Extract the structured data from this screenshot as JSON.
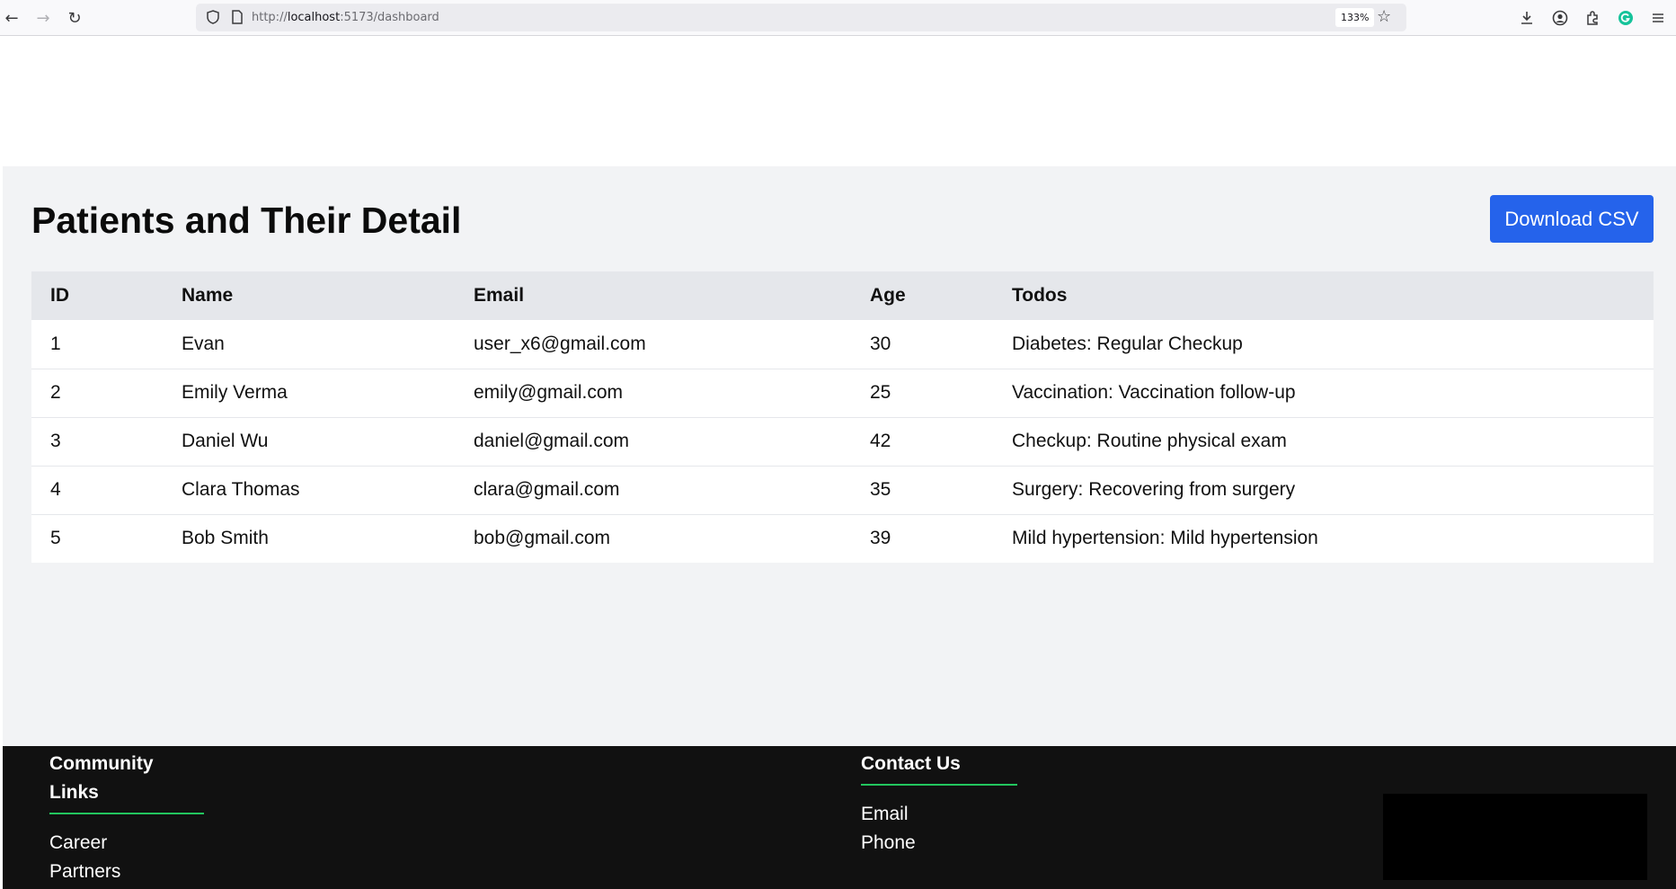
{
  "browser": {
    "url_prefix": "http://",
    "url_host": "localhost",
    "url_rest": ":5173/dashboard",
    "zoom": "133%"
  },
  "page": {
    "title": "Patients and Their Detail",
    "download_button": "Download CSV"
  },
  "table": {
    "headers": [
      "ID",
      "Name",
      "Email",
      "Age",
      "Todos"
    ],
    "rows": [
      [
        "1",
        "Evan",
        "user_x6@gmail.com",
        "30",
        "Diabetes: Regular Checkup"
      ],
      [
        "2",
        "Emily Verma",
        "emily@gmail.com",
        "25",
        "Vaccination: Vaccination follow-up"
      ],
      [
        "3",
        "Daniel Wu",
        "daniel@gmail.com",
        "42",
        "Checkup: Routine physical exam"
      ],
      [
        "4",
        "Clara Thomas",
        "clara@gmail.com",
        "35",
        "Surgery: Recovering from surgery"
      ],
      [
        "5",
        "Bob Smith",
        "bob@gmail.com",
        "39",
        "Mild hypertension: Mild hypertension"
      ]
    ]
  },
  "footer": {
    "community_heading_line1": "Community",
    "community_heading_line2": "Links",
    "community_links": [
      "Career",
      "Partners"
    ],
    "contact_heading": "Contact Us",
    "contact_links": [
      "Email",
      "Phone"
    ]
  },
  "colors": {
    "primary_button": "#2563eb",
    "footer_bg": "#111111",
    "footer_accent": "#22c55e",
    "table_header_bg": "#e5e7eb",
    "main_bg": "#f2f3f5"
  }
}
